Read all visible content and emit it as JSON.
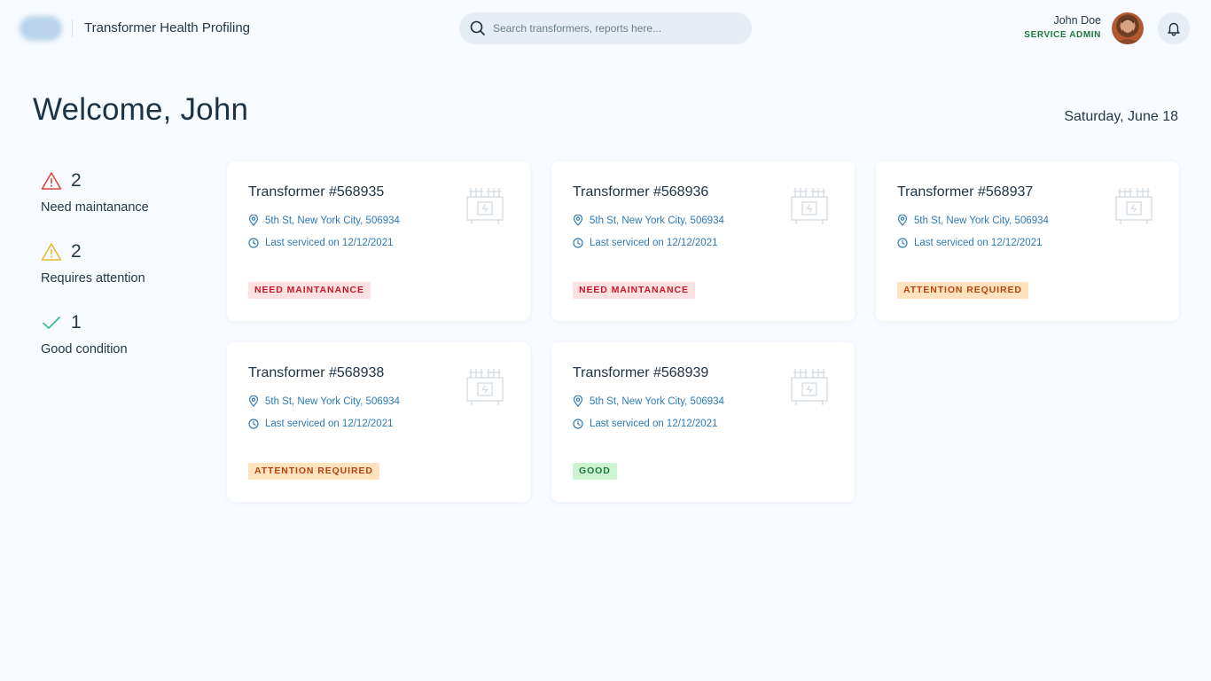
{
  "header": {
    "app_title": "Transformer Health Profiling",
    "search": {
      "placeholder": "Search transformers, reports here..."
    },
    "user": {
      "name": "John Doe",
      "role": "SERVICE ADMIN"
    }
  },
  "welcome": {
    "title": "Welcome, John",
    "date": "Saturday, June 18"
  },
  "summary": [
    {
      "count": "2",
      "label": "Need maintanance",
      "icon": "warning-triangle-icon",
      "color": "#d9463f"
    },
    {
      "count": "2",
      "label": "Requires attention",
      "icon": "warning-triangle-icon",
      "color": "#e8b92e"
    },
    {
      "count": "1",
      "label": "Good condition",
      "icon": "check-icon",
      "color": "#3dbb8a"
    }
  ],
  "cards": [
    {
      "title": "Transformer #568935",
      "address": "5th St, New York City, 506934",
      "serviced": "Last serviced on 12/12/2021",
      "status": "NEED MAINTANANCE",
      "status_type": "danger"
    },
    {
      "title": "Transformer #568936",
      "address": "5th St, New York City, 506934",
      "serviced": "Last serviced on 12/12/2021",
      "status": "NEED MAINTANANCE",
      "status_type": "danger"
    },
    {
      "title": "Transformer #568937",
      "address": "5th St, New York City, 506934",
      "serviced": "Last serviced on 12/12/2021",
      "status": "ATTENTION REQUIRED",
      "status_type": "warning"
    },
    {
      "title": "Transformer #568938",
      "address": "5th St, New York City, 506934",
      "serviced": "Last serviced on 12/12/2021",
      "status": "ATTENTION REQUIRED",
      "status_type": "warning"
    },
    {
      "title": "Transformer #568939",
      "address": "5th St, New York City, 506934",
      "serviced": "Last serviced on 12/12/2021",
      "status": "GOOD",
      "status_type": "good"
    }
  ],
  "colors": {
    "accent": "#2d7bb6",
    "danger_bg": "#fde0e0",
    "danger_text": "#c3192d",
    "warning_bg": "#ffe3bf",
    "warning_text": "#b8420e",
    "good_bg": "#cdf3d2",
    "good_text": "#1d7a35"
  }
}
